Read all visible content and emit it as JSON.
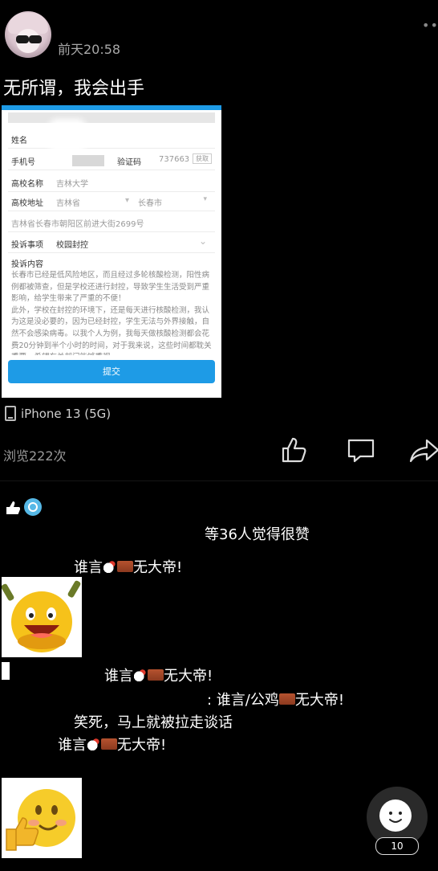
{
  "post": {
    "time": "前天20:58",
    "text": "无所谓，我会出手",
    "device": "iPhone 13 (5G)",
    "views": "浏览222次"
  },
  "form": {
    "name_label": "姓名",
    "phone_label": "手机号",
    "code_label": "验证码",
    "code_value": "737663",
    "code_button": "获取",
    "school_label": "高校名称",
    "school_value": "吉林大学",
    "address_label": "高校地址",
    "province": "吉林省",
    "city": "长春市",
    "street": "吉林省长春市朝阳区前进大街2699号",
    "issue_label": "投诉事项",
    "issue_value": "校园封控",
    "content_label": "投诉内容",
    "content_text": "长春市已经是低风险地区，而且经过多轮核酸检测，阳性病例都被筛查，但是学校还进行封控，导致学生生活受到严重影响，给学生带来了严重的不便！\n此外，学校在封控的环境下，还是每天进行核酸检测，我认为这是没必要的，因为已经封控，学生无法与外界接触，自然不会感染病毒。以我个人为例，我每天做核酸检测都会花费20分钟到半个小时的时间，对于我来说，这些时间都耽关重要，希望有关部门能够重视",
    "submit": "提交"
  },
  "likes": {
    "count_text": "等36人觉得很赞"
  },
  "comments": [
    {
      "text": "谁言"
    },
    {
      "text": "无大帝!"
    },
    {
      "text": "谁言"
    },
    {
      "text": "无大帝!"
    },
    {
      "text": ": 谁言/公鸡"
    },
    {
      "text": "无大帝!"
    },
    {
      "text": "笑死，马上就被拉走谈话"
    },
    {
      "text": "谁言"
    },
    {
      "text": "无大帝!"
    }
  ],
  "fab": {
    "badge": "10"
  },
  "colors": {
    "accent": "#1e9be6",
    "muted": "#a8a8a8"
  }
}
